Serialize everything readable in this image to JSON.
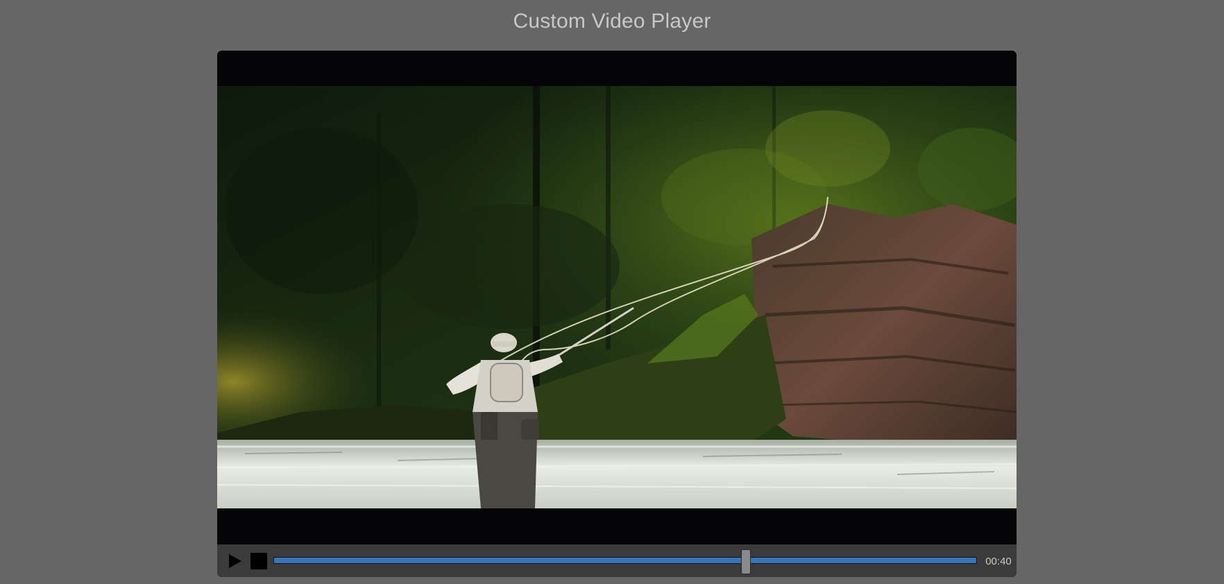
{
  "page": {
    "title": "Custom Video Player"
  },
  "player": {
    "time_display": "00:40",
    "progress_fraction": 0.672,
    "accent_color": "#3a73b8",
    "play_icon": "play-icon",
    "stop_icon": "stop-icon"
  }
}
